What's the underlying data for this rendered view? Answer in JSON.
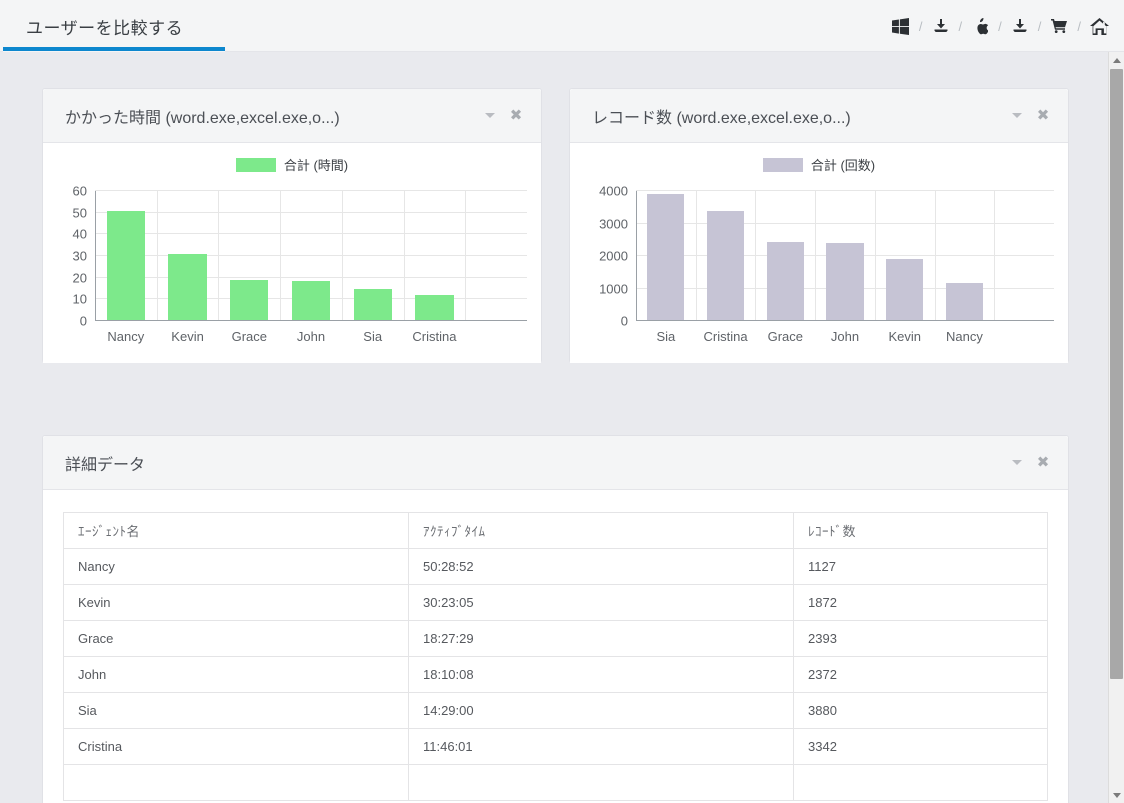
{
  "header": {
    "tab_label": "ユーザーを比較する",
    "accent_color": "#0d87ce",
    "icons": [
      {
        "name": "windows-icon",
        "glyph": "▧"
      },
      {
        "name": "download-icon",
        "glyph": "⤓"
      },
      {
        "name": "apple-icon",
        "glyph": "🍎"
      },
      {
        "name": "download-icon-2",
        "glyph": "⤓"
      },
      {
        "name": "cart-icon",
        "glyph": "🛒"
      },
      {
        "name": "home-icon",
        "glyph": "⌂"
      }
    ],
    "separator": "/"
  },
  "panels": {
    "time_chart": {
      "title": "かかった時間 (word.exe,excel.exe,o...)",
      "collapse_label": "▾",
      "close_label": "✖"
    },
    "record_chart": {
      "title": "レコード数 (word.exe,excel.exe,o...)",
      "collapse_label": "▾",
      "close_label": "✖"
    },
    "detail_table": {
      "title": "詳細データ",
      "collapse_label": "▾",
      "close_label": "✖"
    }
  },
  "chart_data": [
    {
      "id": "time",
      "type": "bar",
      "title": "かかった時間 (word.exe,excel.exe,o...)",
      "legend": [
        "合計 (時間)"
      ],
      "legend_position": "top-center",
      "series_color": "#7de98b",
      "categories": [
        "Nancy",
        "Kevin",
        "Grace",
        "John",
        "Sia",
        "Cristina"
      ],
      "values": [
        50.48,
        30.38,
        18.46,
        18.17,
        14.48,
        11.77
      ],
      "xlabel": "",
      "ylabel": "",
      "ylim": [
        0,
        60
      ],
      "yticks": [
        0,
        10,
        20,
        30,
        40,
        50,
        60
      ],
      "grid": true,
      "empty_slots": 1
    },
    {
      "id": "records",
      "type": "bar",
      "title": "レコード数 (word.exe,excel.exe,o...)",
      "legend": [
        "合計 (回数)"
      ],
      "legend_position": "top-center",
      "series_color": "#c6c4d5",
      "categories": [
        "Sia",
        "Cristina",
        "Grace",
        "John",
        "Kevin",
        "Nancy"
      ],
      "values": [
        3880,
        3342,
        2393,
        2372,
        1872,
        1127
      ],
      "xlabel": "",
      "ylabel": "",
      "ylim": [
        0,
        4000
      ],
      "yticks": [
        0,
        1000,
        2000,
        3000,
        4000
      ],
      "grid": true,
      "empty_slots": 1
    }
  ],
  "table": {
    "columns": [
      "ｴｰｼﾞｪﾝﾄ名",
      "ｱｸﾃｨﾌﾞﾀｲﾑ",
      "ﾚｺｰﾄﾞ数"
    ],
    "rows": [
      [
        "Nancy",
        "50:28:52",
        "1127"
      ],
      [
        "Kevin",
        "30:23:05",
        "1872"
      ],
      [
        "Grace",
        "18:27:29",
        "2393"
      ],
      [
        "John",
        "18:10:08",
        "2372"
      ],
      [
        "Sia",
        "14:29:00",
        "3880"
      ],
      [
        "Cristina",
        "11:46:01",
        "3342"
      ]
    ]
  },
  "scrollbar": {
    "up_label": "▲",
    "down_label": "▼"
  }
}
